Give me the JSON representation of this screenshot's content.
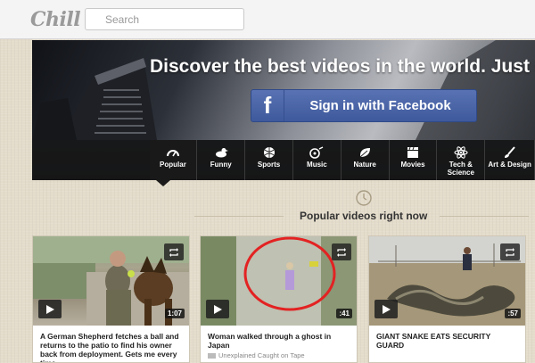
{
  "header": {
    "logo_text": "Chill",
    "search_placeholder": "Search"
  },
  "hero": {
    "headline": "Discover the best videos in the world. Just sign",
    "facebook_button": "Sign in with Facebook",
    "facebook_glyph": "f"
  },
  "categories": [
    {
      "label": "Popular",
      "icon": "gauge-icon",
      "active": true
    },
    {
      "label": "Funny",
      "icon": "duck-icon"
    },
    {
      "label": "Sports",
      "icon": "ball-icon"
    },
    {
      "label": "Music",
      "icon": "music-icon"
    },
    {
      "label": "Nature",
      "icon": "leaf-icon"
    },
    {
      "label": "Movies",
      "icon": "clapper-icon"
    },
    {
      "label": "Tech &",
      "label2": "Science",
      "icon": "atom-icon"
    },
    {
      "label": "Art & Design",
      "icon": "brush-icon"
    }
  ],
  "section": {
    "title": "Popular videos right now",
    "icon": "clock-icon"
  },
  "videos": [
    {
      "title": "A German Shepherd fetches a ball and returns to the patio to find his owner back from deployment. Gets me every time",
      "duration": "1:07"
    },
    {
      "title": "Woman walked through a ghost in Japan",
      "meta": "Unexplained Caught on Tape",
      "duration": ":41"
    },
    {
      "title": "GIANT SNAKE EATS SECURITY GUARD",
      "duration": ":57"
    }
  ]
}
